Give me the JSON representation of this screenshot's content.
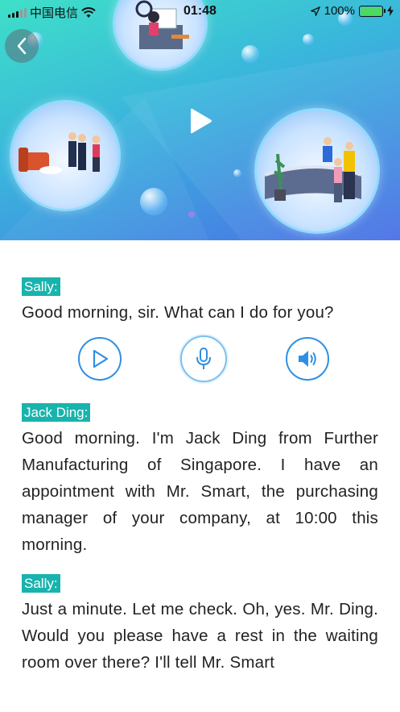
{
  "status_bar": {
    "carrier": "中国电信",
    "time": "01:48",
    "battery": "100%",
    "icons": [
      "signal-icon",
      "wifi-icon",
      "location-arrow-icon",
      "battery-icon",
      "charging-bolt-icon"
    ]
  },
  "hero": {
    "icons": [
      "back-chevron-icon",
      "play-icon"
    ]
  },
  "controls": {
    "icons": [
      "play-icon",
      "microphone-icon",
      "speaker-icon"
    ],
    "accent": "#2f8fe4"
  },
  "dialogue": [
    {
      "speaker": "Sally:",
      "text": "Good morning, sir. What can I do for you?"
    },
    {
      "speaker": "Jack Ding:",
      "text": "Good morning. I'm Jack Ding from Further Manufacturing of Singapore. I have an appointment with Mr. Smart, the purchasing manager of your company, at 10:00 this morning."
    },
    {
      "speaker": "Sally:",
      "text": "Just a minute. Let me check. Oh, yes. Mr. Ding. Would you please have a rest in the waiting room over there? I'll tell Mr. Smart"
    }
  ],
  "colors": {
    "speaker_badge": "#19b3ad",
    "hero_gradient_start": "#3ee0c8",
    "hero_gradient_end": "#4a6fe6"
  }
}
